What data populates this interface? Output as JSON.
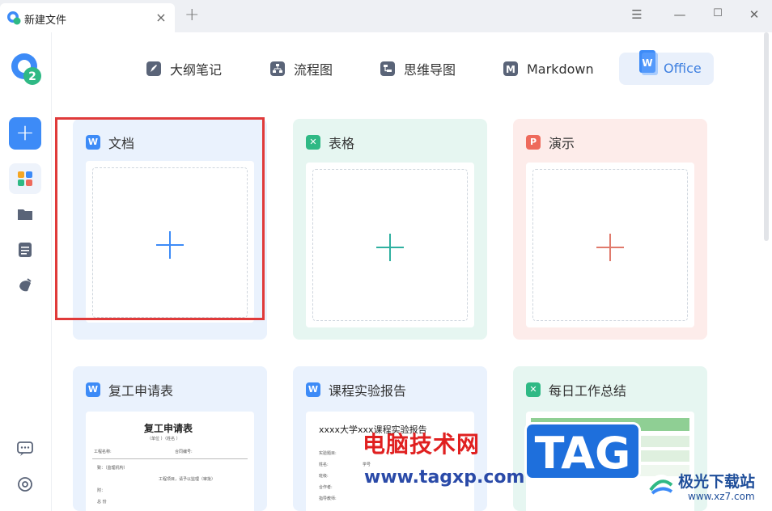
{
  "window": {
    "tab_title": "新建文件",
    "close_glyph": "×",
    "add_glyph": "+",
    "menu_glyph": "☰",
    "minimize_glyph": "—",
    "maximize_glyph": "☐",
    "closewin_glyph": "✕"
  },
  "sidebar": {
    "new_glyph": "+",
    "icons": [
      "templates-icon",
      "folder-icon",
      "document-list-icon",
      "acorn-icon",
      "feedback-icon",
      "settings-icon"
    ]
  },
  "nav": {
    "items": [
      {
        "label": "大纲笔记",
        "icon": "outline-note-icon"
      },
      {
        "label": "流程图",
        "icon": "flowchart-icon"
      },
      {
        "label": "思维导图",
        "icon": "mindmap-icon"
      },
      {
        "label": "Markdown",
        "icon": "markdown-icon"
      },
      {
        "label": "Office",
        "icon": "office-icon",
        "active": true
      }
    ]
  },
  "cards": {
    "new_doc": {
      "badge": "W",
      "label": "文档",
      "color": "#3d8bf7"
    },
    "new_sheet": {
      "badge": "✕",
      "label": "表格",
      "color": "#2fb985"
    },
    "new_slide": {
      "badge": "P",
      "label": "演示",
      "color": "#ee6a5c"
    },
    "tpl_resume": {
      "badge": "W",
      "label": "复工申请表",
      "preview_title": "复工申请表",
      "preview_sub": "（单位   ）（姓名   ）",
      "row1a": "工程名称:",
      "row1b": "合同编号:",
      "row2": "致：（监理机构）",
      "row3": "工程项目，请予以监理（审批）",
      "row4": "附：",
      "row5": "总   份"
    },
    "tpl_report": {
      "badge": "W",
      "label": "课程实验报告",
      "preview_title": "xxxx大学xxx课程实验报告",
      "fields": [
        "实验题目:",
        "姓名:",
        "班级:",
        "合作者:",
        "指导教师:"
      ],
      "field_right": "学号"
    },
    "tpl_summary": {
      "badge": "✕",
      "label": "每日工作总结"
    }
  },
  "watermark": {
    "text": "电脑技术网",
    "url": "www.tagxp.com",
    "tag": "TAG",
    "site_name": "极光下载站",
    "site_url": "www.xz7.com"
  }
}
